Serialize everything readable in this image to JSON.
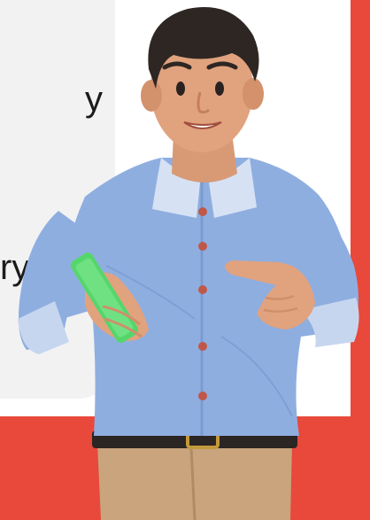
{
  "card": {
    "text_fragment_1": "y",
    "text_fragment_2": "ry"
  },
  "colors": {
    "accent": "#e8493b",
    "card_bg": "#f2f2f2",
    "shirt": "#8faee0",
    "pants": "#c9a47c",
    "phone": "#55d66b"
  },
  "illustration": {
    "subject": "person-holding-phone-pointing"
  }
}
